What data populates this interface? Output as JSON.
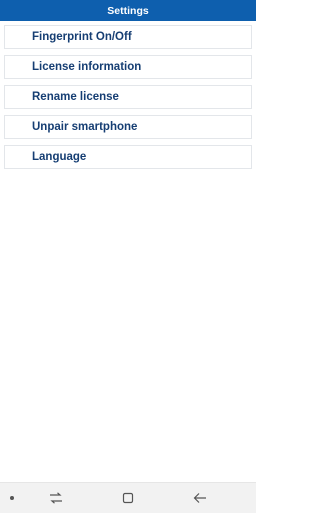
{
  "header": {
    "title": "Settings"
  },
  "menu": {
    "items": [
      {
        "label": "Fingerprint On/Off"
      },
      {
        "label": "License information"
      },
      {
        "label": "Rename license"
      },
      {
        "label": "Unpair smartphone"
      },
      {
        "label": "Language"
      }
    ]
  },
  "navbar": {
    "icons": [
      "dot-icon",
      "recent-apps-icon",
      "home-icon",
      "back-icon"
    ]
  },
  "colors": {
    "header_bg": "#0e5fae",
    "item_text": "#163e73",
    "item_border": "#e3e6ea",
    "navbar_bg": "#f2f2f2"
  }
}
